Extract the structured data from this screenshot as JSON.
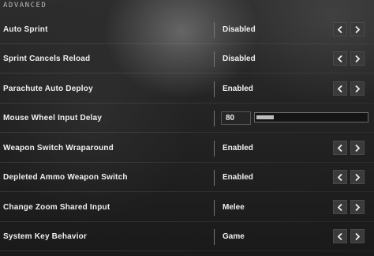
{
  "section": {
    "title": "ADVANCED"
  },
  "settings": [
    {
      "label": "Auto Sprint",
      "value": "Disabled"
    },
    {
      "label": "Sprint Cancels Reload",
      "value": "Disabled"
    },
    {
      "label": "Parachute Auto Deploy",
      "value": "Enabled"
    },
    {
      "label": "Mouse Wheel Input Delay",
      "value": "80",
      "slider_fraction": 0.16
    },
    {
      "label": "Weapon Switch Wraparound",
      "value": "Enabled"
    },
    {
      "label": "Depleted Ammo Weapon Switch",
      "value": "Enabled"
    },
    {
      "label": "Change Zoom Shared Input",
      "value": "Melee"
    },
    {
      "label": "System Key Behavior",
      "value": "Game"
    }
  ],
  "icons": {
    "prev": "chevron-left-icon",
    "next": "chevron-right-icon"
  }
}
